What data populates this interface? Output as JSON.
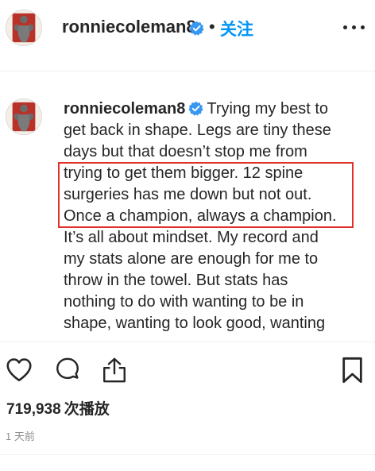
{
  "header": {
    "username": "ronniecoleman8",
    "separator": "•",
    "follow_label": "关注"
  },
  "caption": {
    "username": "ronniecoleman8",
    "lines": [
      "Trying my best to",
      "get back in shape. Legs are tiny these",
      "days but that doesn’t stop me from",
      "trying to get them bigger. 12 spine",
      "surgeries has me down but not out.",
      "Once a champion, always a champion.",
      "It’s all about mindset. My record and",
      "my stats alone are enough for me to",
      "throw in the towel. But stats has",
      "nothing to do with wanting to be in",
      "shape, wanting to look good, wanting"
    ]
  },
  "actions": {
    "icons": [
      "heart-icon",
      "comment-icon",
      "share-icon",
      "bookmark-icon"
    ]
  },
  "stats": {
    "views_count": "719,938",
    "views_label": "次播放",
    "timestamp": "1 天前"
  },
  "colors": {
    "follow": "#0095f6",
    "verified": "#3897f0",
    "highlight_box": "#e0302b",
    "text": "#262626",
    "muted": "#8e8e8e",
    "divider": "#efefef"
  }
}
